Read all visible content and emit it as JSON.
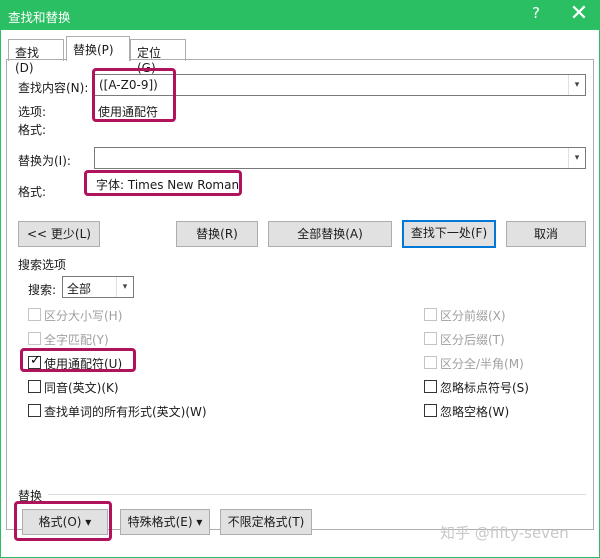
{
  "window": {
    "title": "查找和替换",
    "help": "?",
    "close": "✕"
  },
  "tabs": [
    {
      "label": "查找(D)",
      "active": false
    },
    {
      "label": "替换(P)",
      "active": true
    },
    {
      "label": "定位(G)",
      "active": false
    }
  ],
  "find": {
    "label": "查找内容(N):",
    "value": "([A-Z0-9])",
    "options_label": "选项:",
    "options_value": "使用通配符",
    "format_label": "格式:"
  },
  "replace": {
    "label": "替换为(I):",
    "value": "",
    "format_label": "格式:",
    "format_value": "字体: Times New Roman"
  },
  "buttons": {
    "less": "<< 更少(L)",
    "replace": "替换(R)",
    "replace_all": "全部替换(A)",
    "find_next": "查找下一处(F)",
    "cancel": "取消"
  },
  "search_options": {
    "group_label": "搜索选项",
    "search_label": "搜索:",
    "search_value": "全部"
  },
  "checkboxes_left": [
    {
      "label": "区分大小写(H)",
      "checked": false,
      "disabled": true
    },
    {
      "label": "全字匹配(Y)",
      "checked": false,
      "disabled": true
    },
    {
      "label": "使用通配符(U)",
      "checked": true,
      "disabled": false
    },
    {
      "label": "同音(英文)(K)",
      "checked": false,
      "disabled": false
    },
    {
      "label": "查找单词的所有形式(英文)(W)",
      "checked": false,
      "disabled": false
    }
  ],
  "checkboxes_right": [
    {
      "label": "区分前缀(X)",
      "checked": false,
      "disabled": true
    },
    {
      "label": "区分后缀(T)",
      "checked": false,
      "disabled": true
    },
    {
      "label": "区分全/半角(M)",
      "checked": false,
      "disabled": true
    },
    {
      "label": "忽略标点符号(S)",
      "checked": false,
      "disabled": false
    },
    {
      "label": "忽略空格(W)",
      "checked": false,
      "disabled": false
    }
  ],
  "replace_section": {
    "label": "替换",
    "format_button": "格式(O) ▾",
    "special_button": "特殊格式(E) ▾",
    "no_format_button": "不限定格式(T)"
  },
  "watermark": "知乎 @fifty-seven",
  "colors": {
    "titlebar": "#2bbf64",
    "highlight": "#b0135c",
    "default_button": "#0078d7"
  }
}
